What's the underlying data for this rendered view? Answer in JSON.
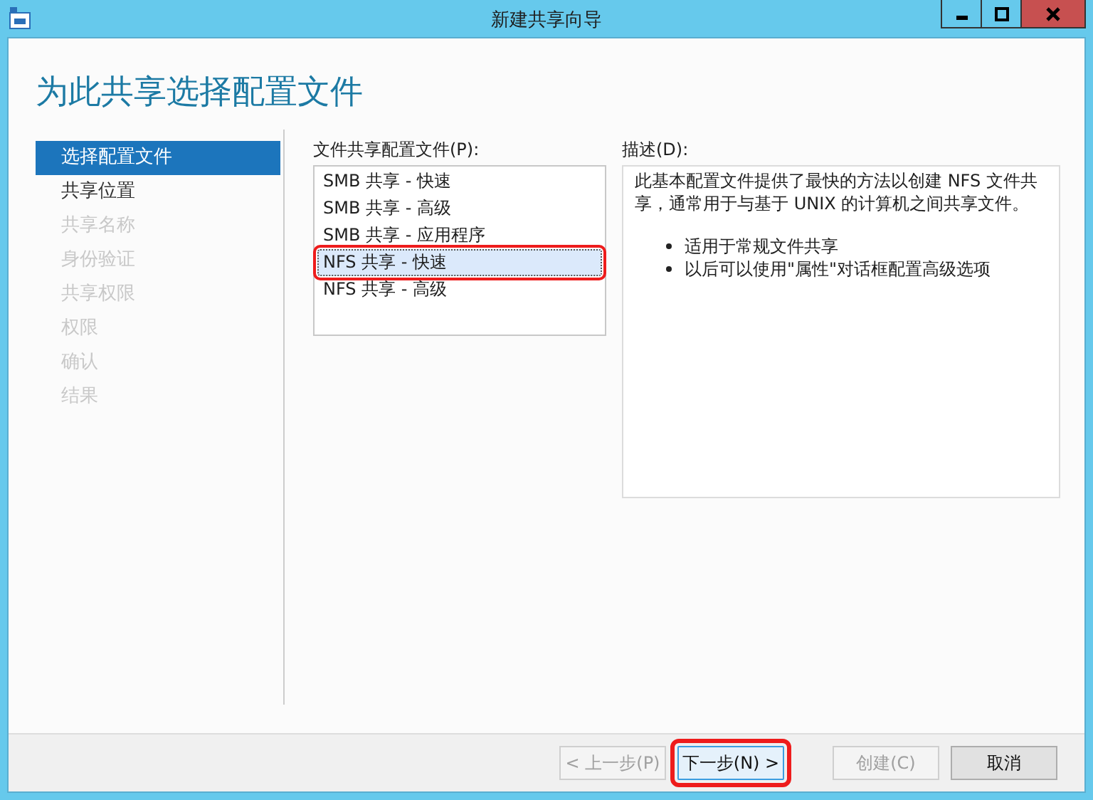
{
  "window": {
    "title": "新建共享向导"
  },
  "heading": "为此共享选择配置文件",
  "steps": [
    {
      "label": "选择配置文件",
      "selected": true,
      "disabled": false
    },
    {
      "label": "共享位置",
      "selected": false,
      "disabled": false
    },
    {
      "label": "共享名称",
      "selected": false,
      "disabled": true
    },
    {
      "label": "身份验证",
      "selected": false,
      "disabled": true
    },
    {
      "label": "共享权限",
      "selected": false,
      "disabled": true
    },
    {
      "label": "权限",
      "selected": false,
      "disabled": true
    },
    {
      "label": "确认",
      "selected": false,
      "disabled": true
    },
    {
      "label": "结果",
      "selected": false,
      "disabled": true
    }
  ],
  "profiles": {
    "label": "文件共享配置文件(P):",
    "items": [
      {
        "label": "SMB 共享 - 快速",
        "selected": false,
        "highlighted": false
      },
      {
        "label": "SMB 共享 - 高级",
        "selected": false,
        "highlighted": false
      },
      {
        "label": "SMB 共享 - 应用程序",
        "selected": false,
        "highlighted": false
      },
      {
        "label": "NFS 共享 - 快速",
        "selected": true,
        "highlighted": true
      },
      {
        "label": "NFS 共享 - 高级",
        "selected": false,
        "highlighted": false
      }
    ]
  },
  "description": {
    "label": "描述(D):",
    "text": "此基本配置文件提供了最快的方法以创建 NFS 文件共享，通常用于与基于 UNIX 的计算机之间共享文件。",
    "bullets": [
      "适用于常规文件共享",
      "以后可以使用\"属性\"对话框配置高级选项"
    ]
  },
  "buttons": [
    {
      "label": "< 上一步(P)",
      "disabled": true,
      "default": false,
      "highlighted": false
    },
    {
      "label": "下一步(N) >",
      "disabled": false,
      "default": true,
      "highlighted": true
    },
    {
      "label": "创建(C)",
      "disabled": true,
      "default": false,
      "highlighted": false
    },
    {
      "label": "取消",
      "disabled": false,
      "default": false,
      "highlighted": false
    }
  ]
}
